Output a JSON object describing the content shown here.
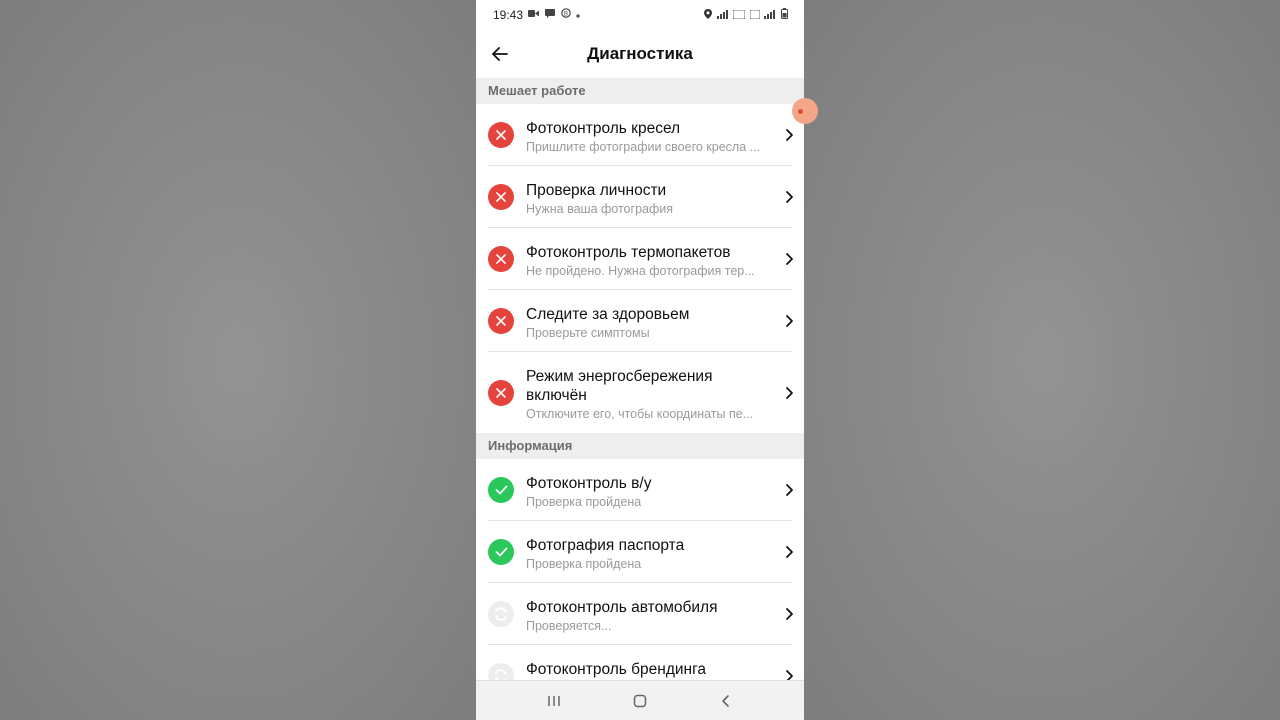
{
  "status_bar": {
    "time": "19:43",
    "left_icons": [
      "video-icon",
      "message-icon",
      "cast-icon",
      "dot-icon"
    ],
    "right_icons": [
      "location-icon",
      "signal-icon",
      "volte-icon",
      "4g-icon",
      "signal-icon",
      "battery-icon"
    ]
  },
  "header": {
    "title": "Диагностика",
    "back_icon": "arrow-left-icon"
  },
  "sections": [
    {
      "title": "Мешает работе",
      "items": [
        {
          "title": "Фотоконтроль кресел",
          "subtitle": "Пришлите фотографии своего кресла ...",
          "status": "error"
        },
        {
          "title": "Проверка личности",
          "subtitle": "Нужна ваша фотография",
          "status": "error"
        },
        {
          "title": "Фотоконтроль термопакетов",
          "subtitle": "Не пройдено. Нужна фотография тер...",
          "status": "error"
        },
        {
          "title": "Следите за здоровьем",
          "subtitle": "Проверьте симптомы",
          "status": "error"
        },
        {
          "title": "Режим энергосбережения включён",
          "subtitle": "Отключите его, чтобы координаты пе...",
          "status": "error"
        }
      ]
    },
    {
      "title": "Информация",
      "items": [
        {
          "title": "Фотоконтроль в/у",
          "subtitle": "Проверка пройдена",
          "status": "ok"
        },
        {
          "title": "Фотография паспорта",
          "subtitle": "Проверка пройдена",
          "status": "ok"
        },
        {
          "title": "Фотоконтроль автомобиля",
          "subtitle": "Проверяется...",
          "status": "pending"
        },
        {
          "title": "Фотоконтроль брендинга",
          "subtitle": "",
          "status": "pending"
        }
      ]
    }
  ],
  "nav_bar": {
    "icons": [
      "recents-icon",
      "home-icon",
      "back-icon"
    ]
  },
  "colors": {
    "error": "#e5443d",
    "ok": "#2ac75a",
    "pending": "#ededed",
    "section_bg": "#eeeeee"
  }
}
